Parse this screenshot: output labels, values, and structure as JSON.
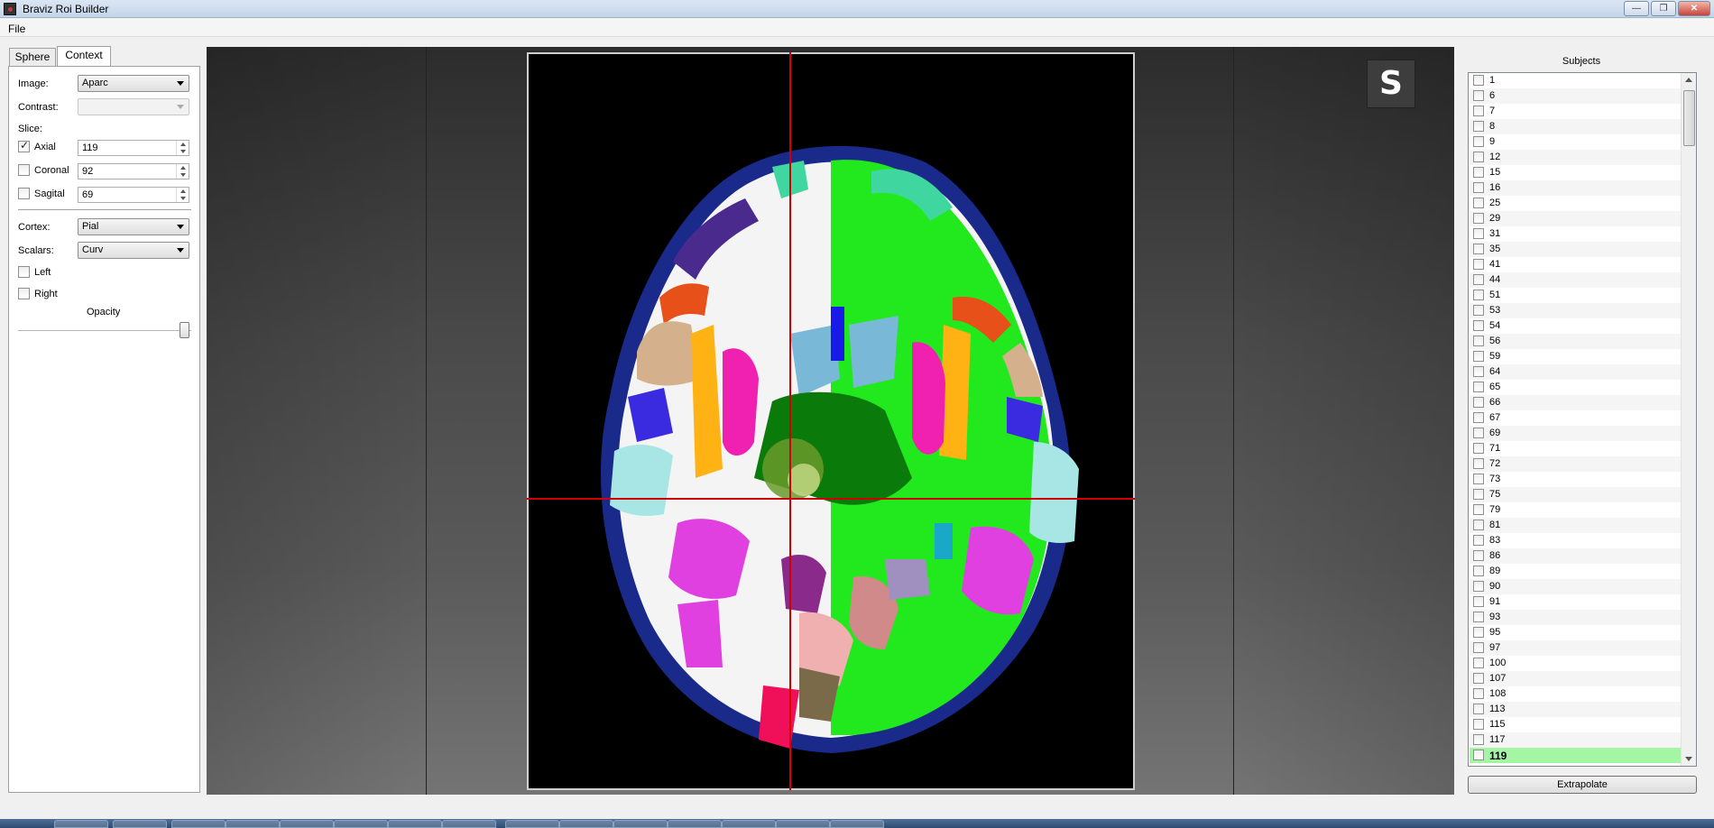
{
  "window": {
    "title": "Braviz Roi Builder",
    "minimize": "—",
    "restore": "❐",
    "close": "✕"
  },
  "menu": {
    "file": "File"
  },
  "tabs": [
    {
      "label": "Sphere"
    },
    {
      "label": "Context"
    }
  ],
  "context": {
    "image_label": "Image:",
    "image_value": "Aparc",
    "contrast_label": "Contrast:",
    "contrast_value": "",
    "slice_label": "Slice:",
    "axial_label": "Axial",
    "axial_value": "119",
    "axial_checked": true,
    "coronal_label": "Coronal",
    "coronal_value": "92",
    "coronal_checked": false,
    "sagital_label": "Sagital",
    "sagital_value": "69",
    "sagital_checked": false,
    "cortex_label": "Cortex:",
    "cortex_value": "Pial",
    "scalars_label": "Scalars:",
    "scalars_value": "Curv",
    "left_label": "Left",
    "left_checked": false,
    "right_label": "Right",
    "right_checked": false,
    "opacity_label": "Opacity",
    "opacity_level": 1.0
  },
  "viewer": {
    "logo_letter": "S"
  },
  "subjects": {
    "title": "Subjects",
    "items": [
      "1",
      "6",
      "7",
      "8",
      "9",
      "12",
      "15",
      "16",
      "25",
      "29",
      "31",
      "35",
      "41",
      "44",
      "51",
      "53",
      "54",
      "56",
      "59",
      "64",
      "65",
      "66",
      "67",
      "69",
      "71",
      "72",
      "73",
      "75",
      "79",
      "81",
      "83",
      "86",
      "89",
      "90",
      "91",
      "93",
      "95",
      "97",
      "100",
      "107",
      "108",
      "113",
      "115",
      "117",
      "119"
    ],
    "selected": "119"
  },
  "buttons": {
    "extrapolate": "Extrapolate"
  },
  "colors": {
    "crosshair": "#d00000",
    "selected_row": "#a4f5a4"
  }
}
